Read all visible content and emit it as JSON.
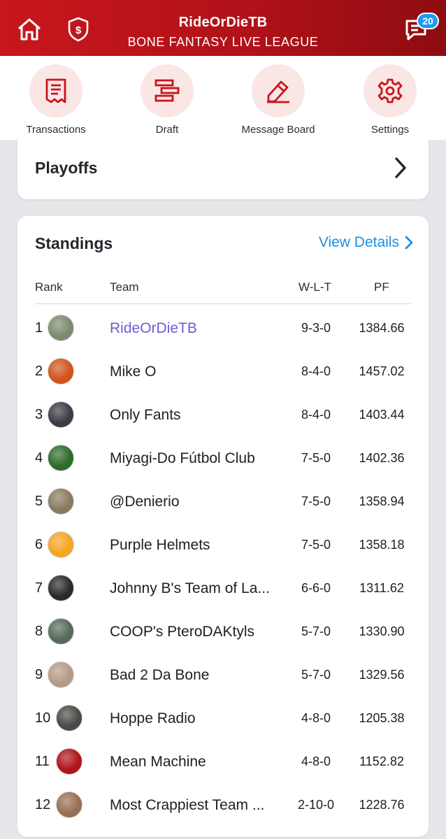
{
  "header": {
    "title": "RideOrDieTB",
    "subtitle": "BONE FANTASY LIVE LEAGUE",
    "notification_count": "20",
    "icons": [
      "home-icon",
      "money-shield-icon",
      "message-icon"
    ]
  },
  "quicknav": [
    {
      "label": "Transactions",
      "icon": "receipt-icon"
    },
    {
      "label": "Draft",
      "icon": "draft-icon"
    },
    {
      "label": "Message Board",
      "icon": "pencil-icon"
    },
    {
      "label": "Settings",
      "icon": "gear-icon"
    }
  ],
  "playoffs": {
    "label": "Playoffs"
  },
  "standings": {
    "title": "Standings",
    "view_details": "View Details",
    "columns": {
      "rank": "Rank",
      "team": "Team",
      "wlt": "W-L-T",
      "pf": "PF"
    },
    "rows": [
      {
        "rank": "1",
        "team": "RideOrDieTB",
        "wlt": "9-3-0",
        "pf": "1384.66",
        "avatar": "#7c8a6f"
      },
      {
        "rank": "2",
        "team": "Mike O",
        "wlt": "8-4-0",
        "pf": "1457.02",
        "avatar": "#d2541c"
      },
      {
        "rank": "3",
        "team": "Only Fants",
        "wlt": "8-4-0",
        "pf": "1403.44",
        "avatar": "#3a3d44"
      },
      {
        "rank": "4",
        "team": "Miyagi-Do Fútbol Club",
        "wlt": "7-5-0",
        "pf": "1402.36",
        "avatar": "#2f6b2a"
      },
      {
        "rank": "5",
        "team": "@Denierio",
        "wlt": "7-5-0",
        "pf": "1358.94",
        "avatar": "#8a7a60"
      },
      {
        "rank": "6",
        "team": "Purple Helmets",
        "wlt": "7-5-0",
        "pf": "1358.18",
        "avatar": "#f5a623"
      },
      {
        "rank": "7",
        "team": "Johnny B's Team of La...",
        "wlt": "6-6-0",
        "pf": "1311.62",
        "avatar": "#2a2a2a"
      },
      {
        "rank": "8",
        "team": "COOP's PteroDAKtyls",
        "wlt": "5-7-0",
        "pf": "1330.90",
        "avatar": "#556b58"
      },
      {
        "rank": "9",
        "team": "Bad 2 Da Bone",
        "wlt": "5-7-0",
        "pf": "1329.56",
        "avatar": "#b79a86"
      },
      {
        "rank": "10",
        "team": "Hoppe Radio",
        "wlt": "4-8-0",
        "pf": "1205.38",
        "avatar": "#4b4a47"
      },
      {
        "rank": "11",
        "team": "Mean Machine",
        "wlt": "4-8-0",
        "pf": "1152.82",
        "avatar": "#b0141a"
      },
      {
        "rank": "12",
        "team": "Most Crappiest Team ...",
        "wlt": "2-10-0",
        "pf": "1228.76",
        "avatar": "#9a6e54"
      }
    ]
  },
  "colors": {
    "brand_red": "#c8161d",
    "link_blue": "#1f8fe0",
    "my_team": "#6a5fd0"
  }
}
